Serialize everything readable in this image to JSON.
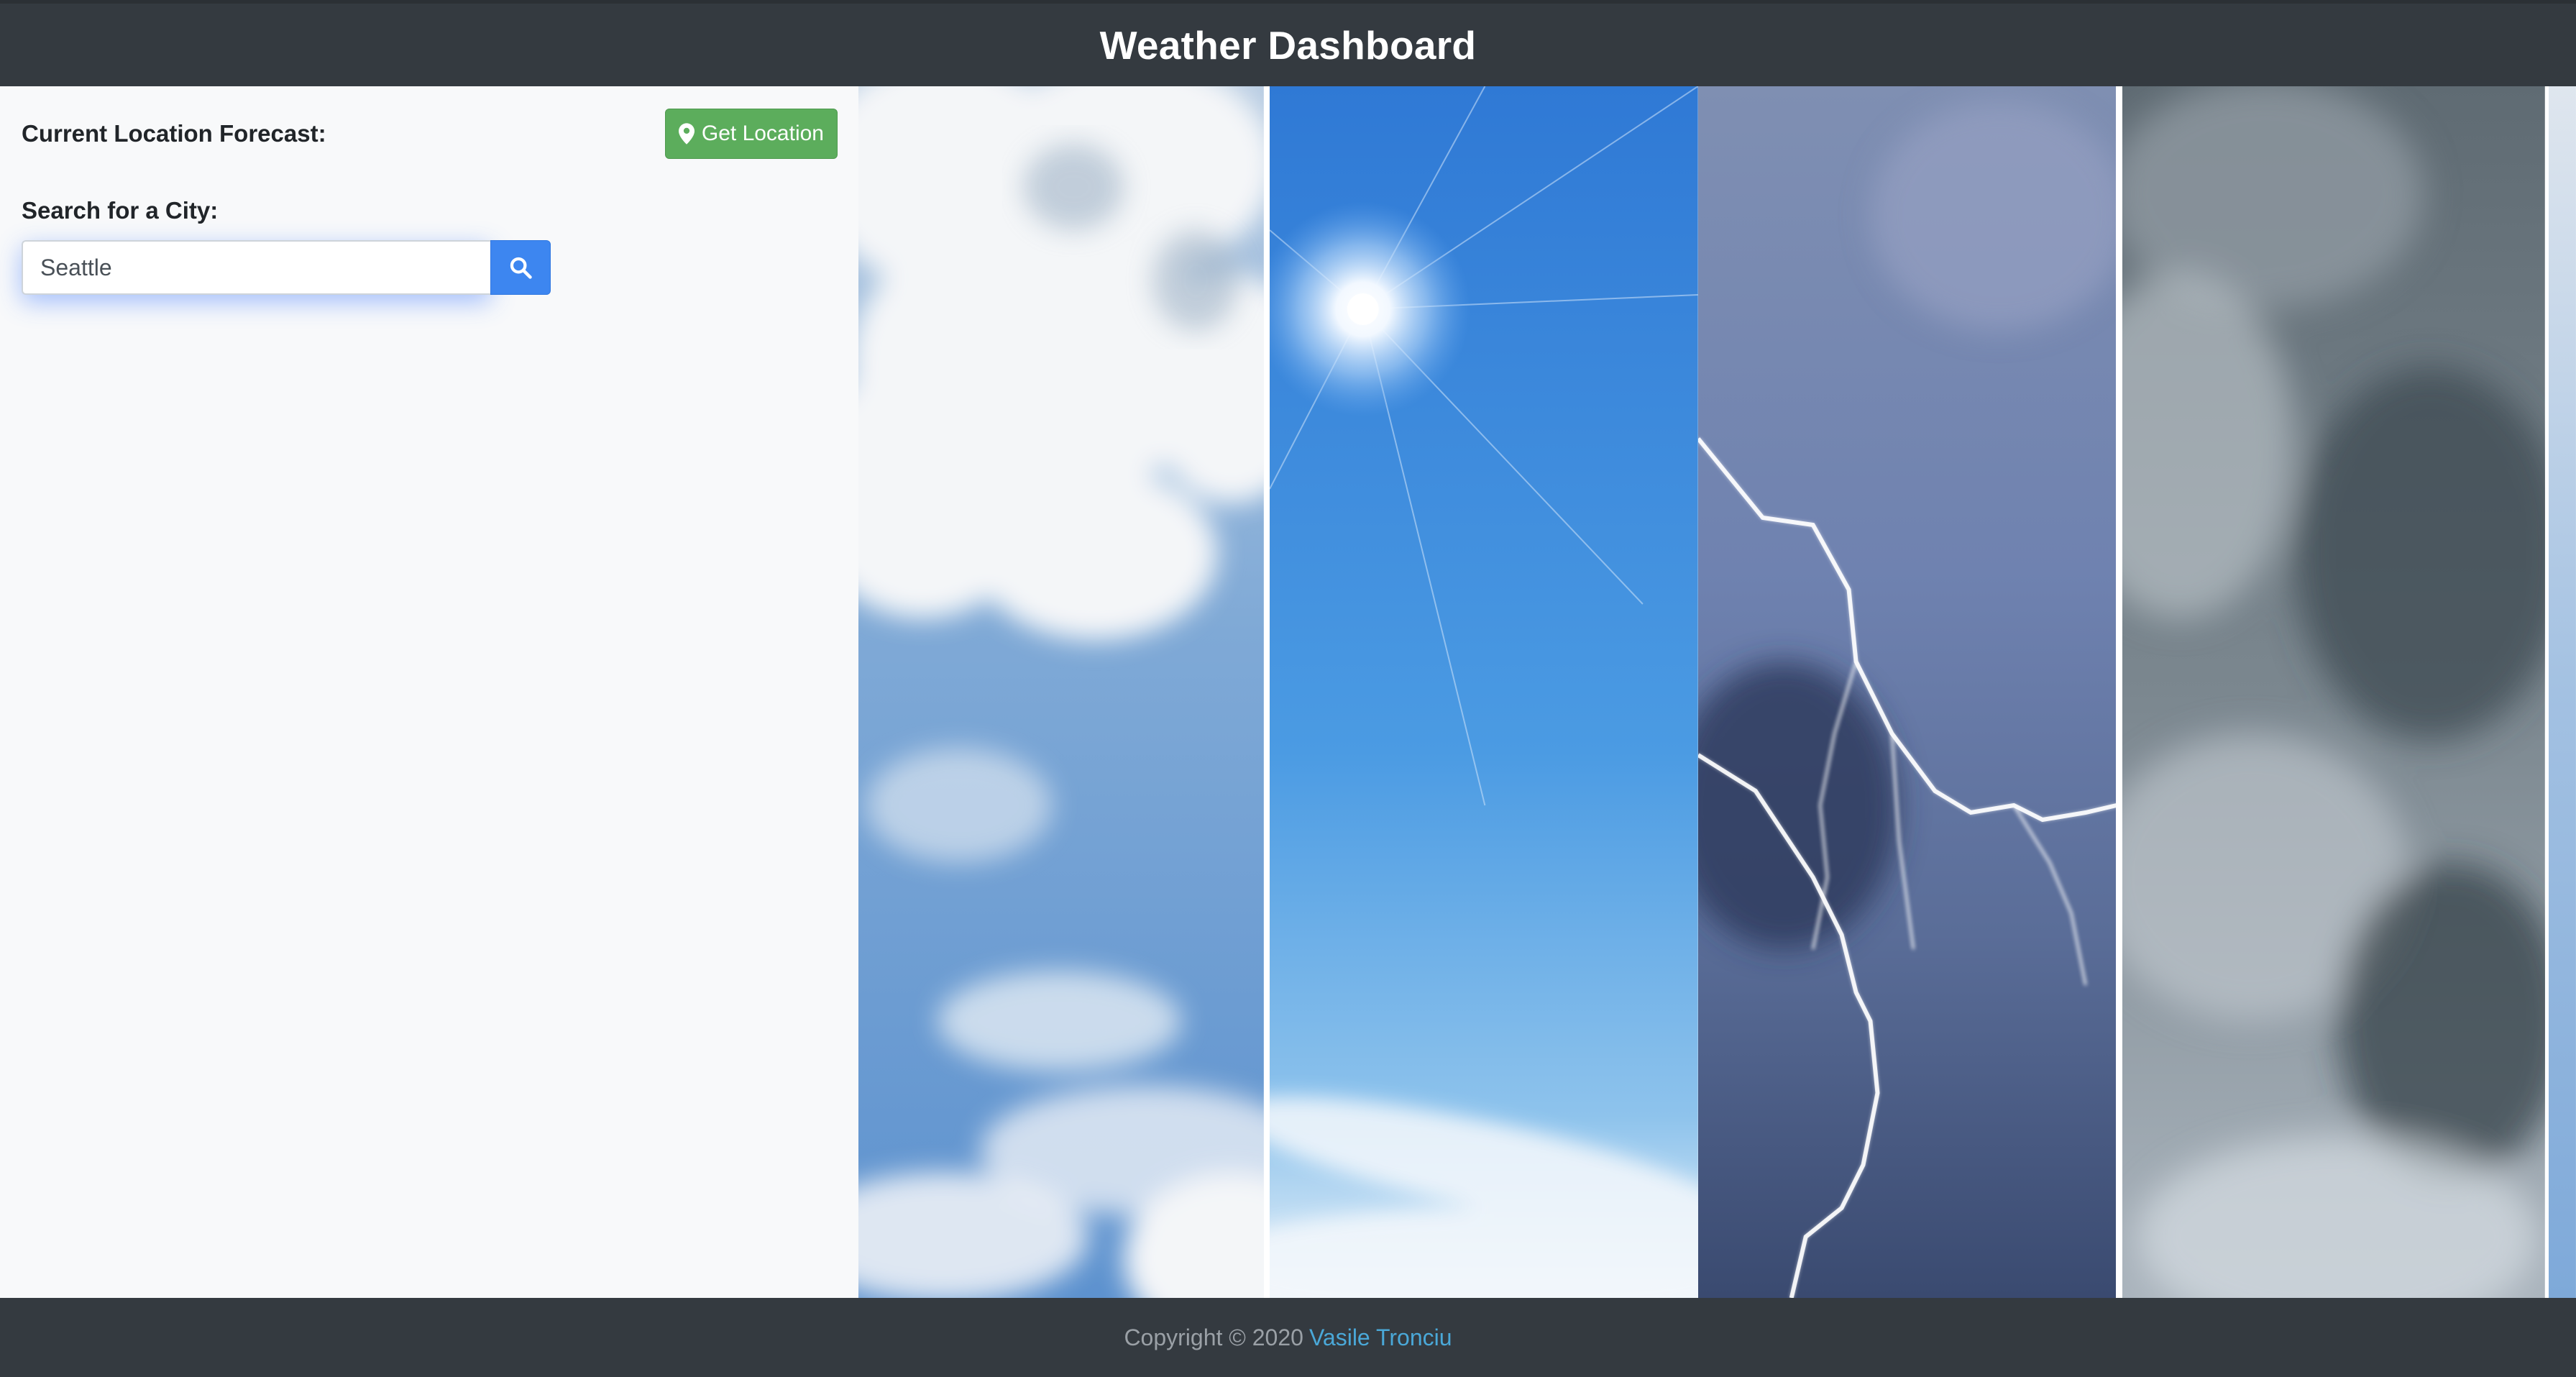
{
  "header": {
    "title": "Weather Dashboard"
  },
  "sidebar": {
    "current_location_label": "Current Location Forecast:",
    "get_location_button": "Get Location",
    "search_label": "Search for a City:",
    "search_input_value": "Seattle",
    "search_button_icon": "search-icon"
  },
  "weather_panels": [
    "cloudy",
    "sunny",
    "thunderstorm",
    "overcast",
    "cloudy"
  ],
  "footer": {
    "copyright_text": "Copyright © 2020",
    "author_link": "Vasile Tronciu"
  },
  "colors": {
    "header_bg": "#343a40",
    "sidebar_bg": "#f8f9fa",
    "location_button": "#5cad5c",
    "search_button": "#3d86f0",
    "link": "#4aa8d8"
  }
}
